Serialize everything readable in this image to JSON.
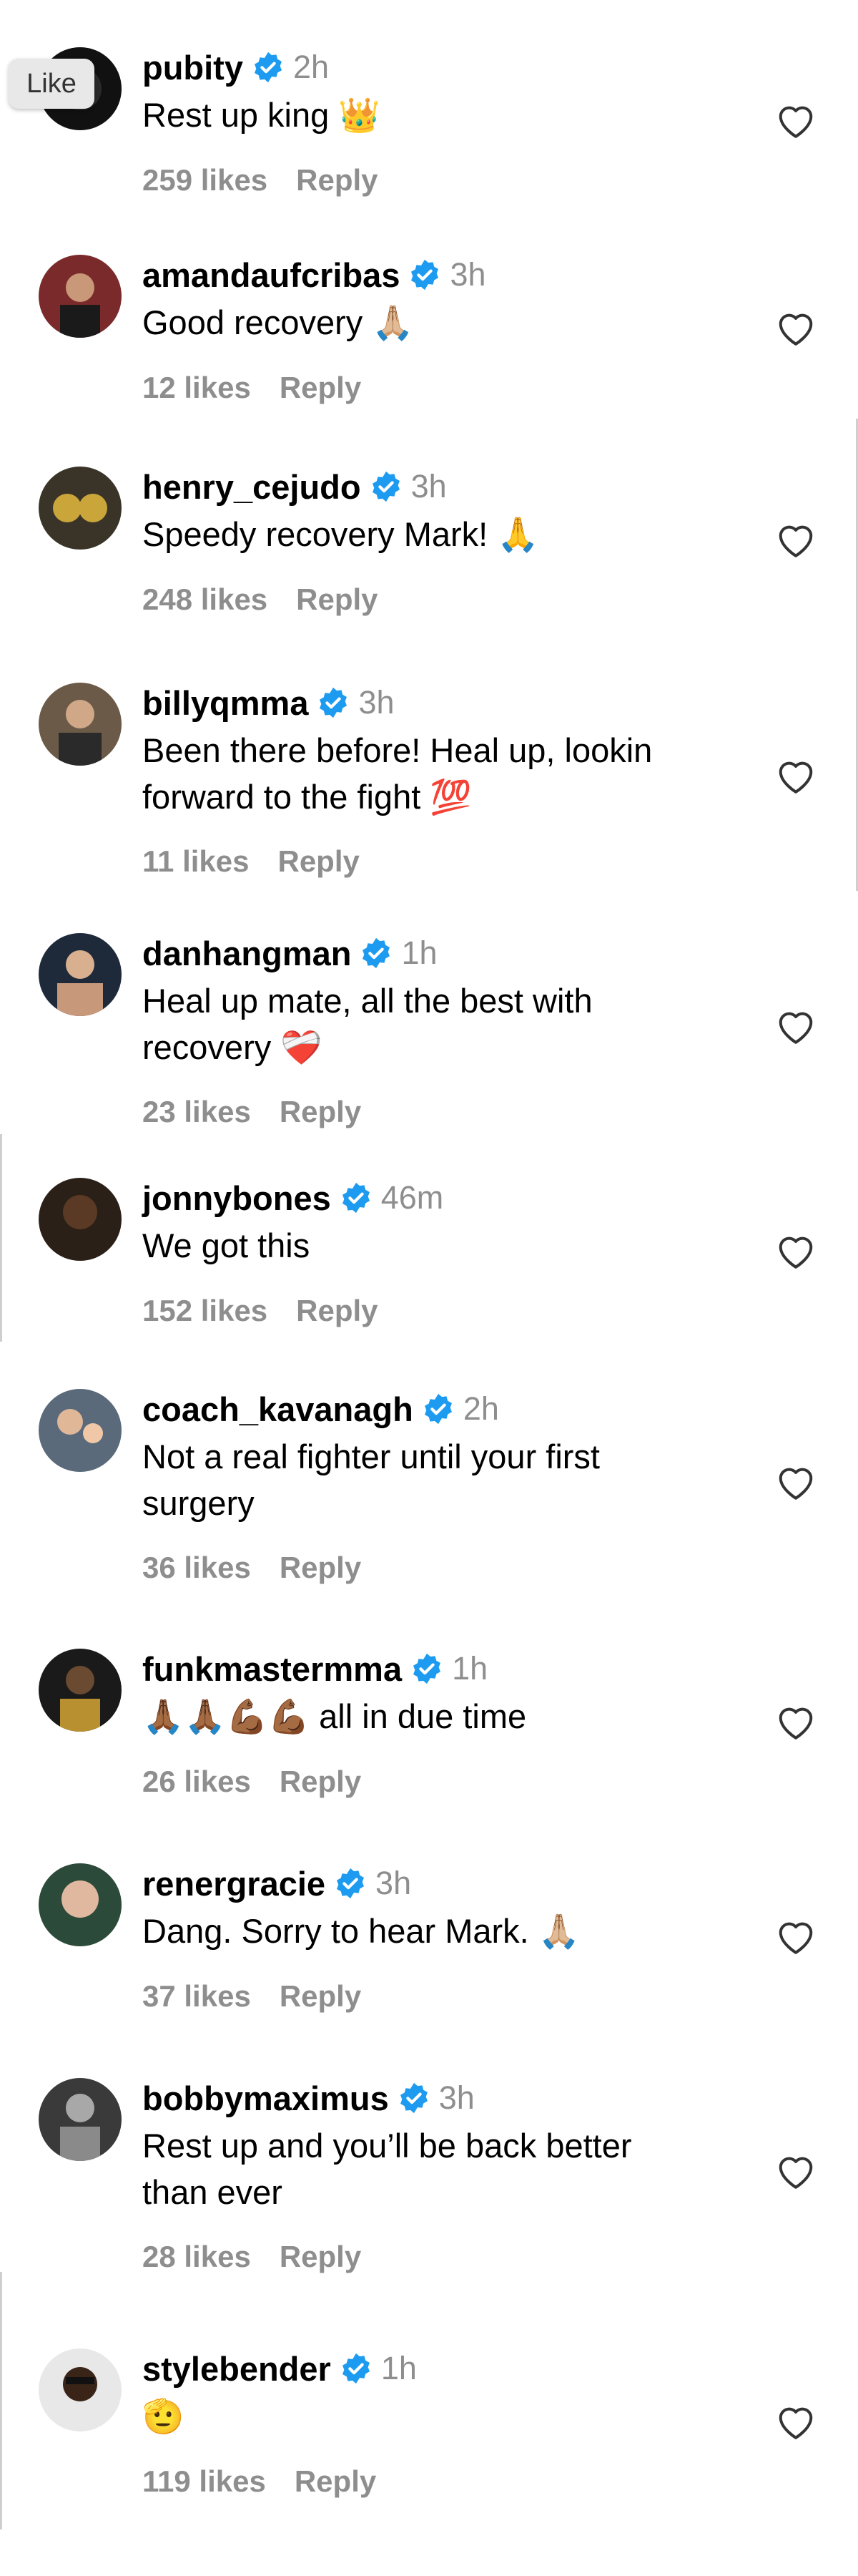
{
  "tooltip": {
    "label": "Like"
  },
  "comments": [
    {
      "username": "pubity",
      "time": "2h",
      "text": "Rest up king",
      "emoji": "👑",
      "likes": "259 likes",
      "reply": "Reply",
      "avatar_color": "#111111"
    },
    {
      "username": "amandaufcribas",
      "time": "3h",
      "text": "Good recovery",
      "emoji": "🙏🏼",
      "likes": "12 likes",
      "reply": "Reply",
      "avatar_color": "#7a2a2a"
    },
    {
      "username": "henry_cejudo",
      "time": "3h",
      "text": "Speedy recovery Mark!",
      "emoji": "🙏",
      "likes": "248 likes",
      "reply": "Reply",
      "avatar_color": "#3a3428"
    },
    {
      "username": "billyqmma",
      "time": "3h",
      "text": "Been there before! Heal up, lookin\nforward to the fight",
      "emoji": "💯",
      "likes": "11 likes",
      "reply": "Reply",
      "avatar_color": "#6b5a48"
    },
    {
      "username": "danhangman",
      "time": "1h",
      "text": "Heal up mate, all the best with\nrecovery",
      "emoji": "❤️‍🩹",
      "likes": "23 likes",
      "reply": "Reply",
      "avatar_color": "#1e2a3a"
    },
    {
      "username": "jonnybones",
      "time": "46m",
      "text": "We got this",
      "emoji": "",
      "likes": "152 likes",
      "reply": "Reply",
      "avatar_color": "#2a2018"
    },
    {
      "username": "coach_kavanagh",
      "time": "2h",
      "text": "Not a real fighter until your first\nsurgery",
      "emoji": "",
      "likes": "36 likes",
      "reply": "Reply",
      "avatar_color": "#5a6a7a"
    },
    {
      "username": "funkmastermma",
      "time": "1h",
      "text": "all in due time",
      "emoji": "🙏🏾🙏🏾💪🏾💪🏾",
      "likes": "26 likes",
      "reply": "Reply",
      "avatar_color": "#1a1a1a"
    },
    {
      "username": "renergracie",
      "time": "3h",
      "text": "Dang. Sorry to hear Mark.",
      "emoji": "🙏🏼",
      "likes": "37 likes",
      "reply": "Reply",
      "avatar_color": "#2c4a3a"
    },
    {
      "username": "bobbymaximus",
      "time": "3h",
      "text": "Rest up and you’ll be back better\nthan ever",
      "emoji": "",
      "likes": "28 likes",
      "reply": "Reply",
      "avatar_color": "#3a3a3a"
    },
    {
      "username": "stylebender",
      "time": "1h",
      "text": "",
      "emoji": "🫡",
      "likes": "119 likes",
      "reply": "Reply",
      "avatar_color": "#e8e8e8"
    }
  ]
}
